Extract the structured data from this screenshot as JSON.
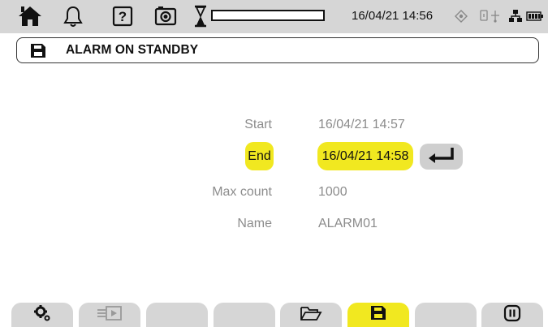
{
  "status_bar": {
    "datetime": "16/04/21 14:56",
    "icons": [
      "home-icon",
      "bell-icon",
      "help-icon",
      "camera-icon",
      "hourglass-icon",
      "gps-icon",
      "usb-icon",
      "network-icon",
      "battery-icon"
    ],
    "progress_value": 0
  },
  "title_bar": {
    "icon": "save-icon",
    "title": "ALARM ON STANDBY"
  },
  "form": {
    "fields": [
      {
        "label": "Start",
        "value": "16/04/21 14:57"
      },
      {
        "label": "End",
        "value": "16/04/21 14:58"
      },
      {
        "label": "Max count",
        "value": "1000"
      },
      {
        "label": "Name",
        "value": "ALARM01"
      }
    ],
    "selected_field": "End",
    "enter_icon": "enter-icon"
  },
  "function_keys": [
    {
      "icon": "settings-icon",
      "active": false
    },
    {
      "icon": "start-icon",
      "active": false
    },
    {
      "icon": "",
      "active": false
    },
    {
      "icon": "",
      "active": false
    },
    {
      "icon": "folder-icon",
      "active": false
    },
    {
      "icon": "save-icon",
      "active": true
    },
    {
      "icon": "",
      "active": false
    },
    {
      "icon": "pause-icon",
      "active": false
    }
  ],
  "colors": {
    "highlight": "#f1e820",
    "bar_gray": "#d6d6d6",
    "label_gray": "#8c8c8c"
  }
}
